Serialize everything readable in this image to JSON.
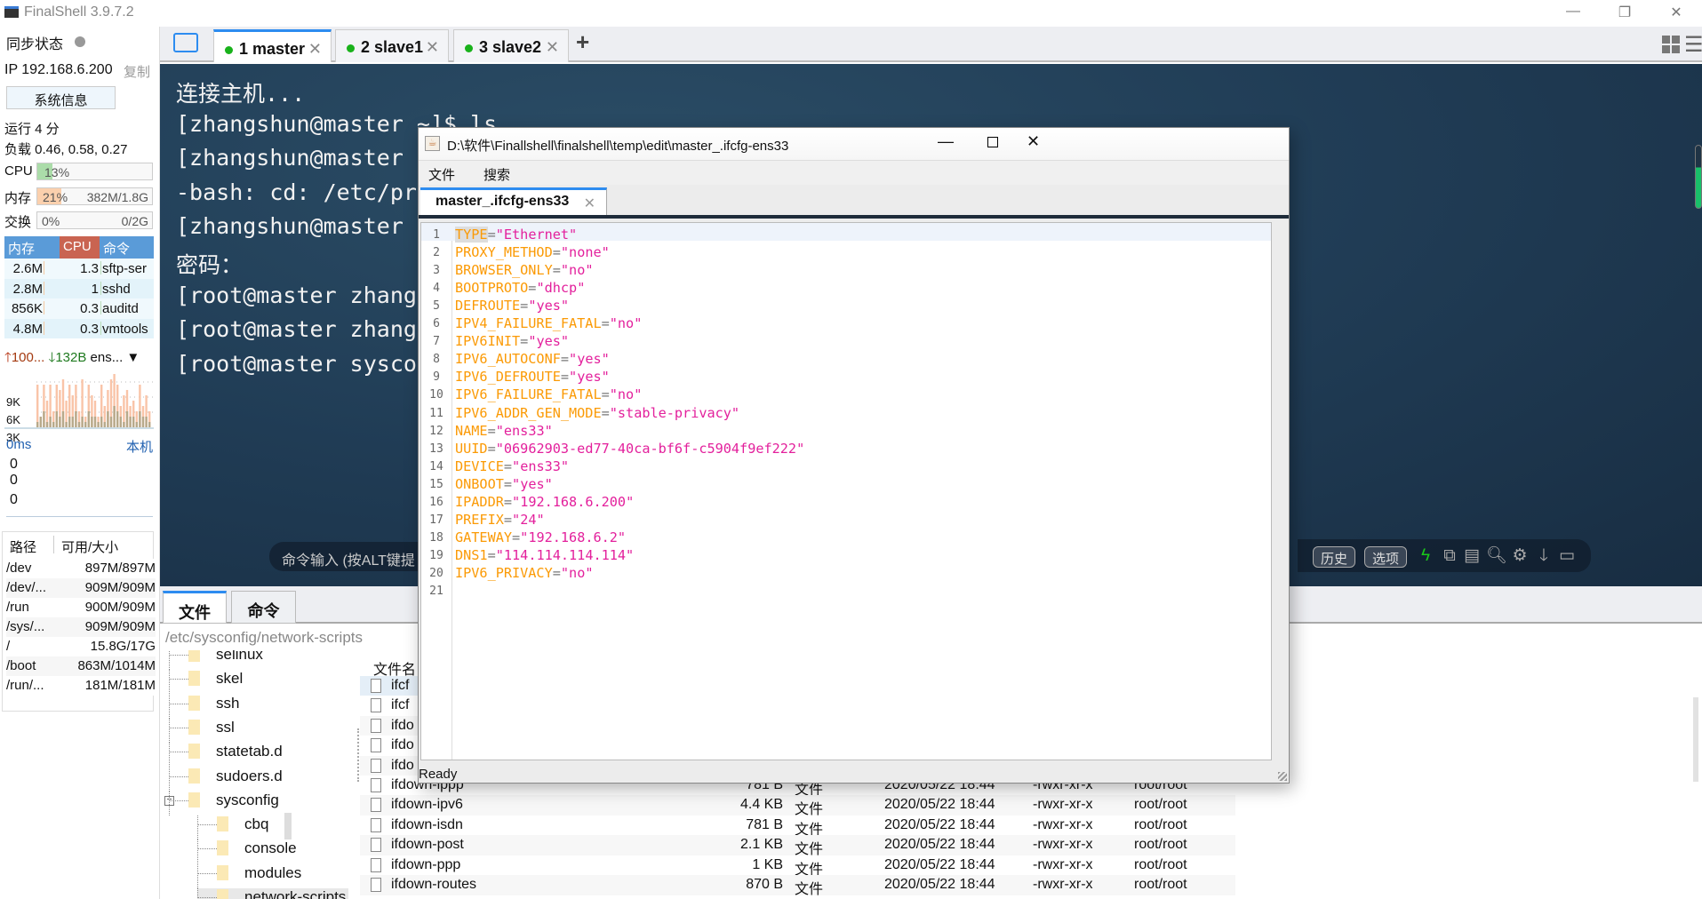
{
  "app": {
    "title": "FinalShell 3.9.7.2"
  },
  "sidebar": {
    "sync_label": "同步状态",
    "ip": "IP 192.168.6.200",
    "copy": "复制",
    "sysinfo_button": "系统信息",
    "uptime": "运行 4 分",
    "load": "负载 0.46, 0.58, 0.27",
    "cpu": {
      "label": "CPU",
      "percent": 13,
      "text": "13%"
    },
    "mem": {
      "label": "内存",
      "percent": 21,
      "text": "21%",
      "detail": "382M/1.8G"
    },
    "swap": {
      "label": "交换",
      "percent": 0,
      "text": "0%",
      "detail": "0/2G"
    },
    "proc_headers": [
      "内存",
      "CPU",
      "命令"
    ],
    "procs": [
      {
        "mem": "2.6M",
        "cpu": "1.3",
        "cmd": "sftp-ser"
      },
      {
        "mem": "2.8M",
        "cpu": "1",
        "cmd": "sshd"
      },
      {
        "mem": "856K",
        "cpu": "0.3",
        "cmd": "auditd"
      },
      {
        "mem": "4.8M",
        "cpu": "0.3",
        "cmd": "vmtools"
      }
    ],
    "net": {
      "up": "100...",
      "down": "132B",
      "iface": "ens...",
      "y_ticks": [
        "9K",
        "6K",
        "3K"
      ],
      "up_series": [
        8,
        1,
        8,
        5,
        8,
        3,
        8,
        7,
        9,
        5,
        8,
        6,
        8,
        3,
        9,
        2,
        8,
        6,
        5,
        2,
        8,
        4,
        7,
        9,
        10,
        8,
        4,
        6,
        7,
        4,
        5,
        3,
        8,
        4,
        6,
        3
      ],
      "down_series": [
        1,
        2,
        3,
        1,
        2,
        1,
        3,
        2,
        3,
        1,
        2,
        2,
        3,
        1,
        2,
        1,
        3,
        2,
        2,
        1,
        2,
        1,
        3,
        2,
        4,
        3,
        2,
        1,
        3,
        2,
        2,
        1,
        3,
        2,
        2,
        1
      ]
    },
    "ping": {
      "latency": "0ms",
      "target": "本机",
      "values": [
        "0",
        "0",
        "0"
      ]
    },
    "disk_headers": [
      "路径",
      "可用/大小"
    ],
    "disks": [
      {
        "path": "/dev",
        "size": "897M/897M"
      },
      {
        "path": "/dev/...",
        "size": "909M/909M"
      },
      {
        "path": "/run",
        "size": "900M/909M"
      },
      {
        "path": "/sys/...",
        "size": "909M/909M"
      },
      {
        "path": "/",
        "size": "15.8G/17G"
      },
      {
        "path": "/boot",
        "size": "863M/1014M"
      },
      {
        "path": "/run/...",
        "size": "181M/181M"
      }
    ]
  },
  "tabs": [
    {
      "label": "1 master"
    },
    {
      "label": "2 slave1"
    },
    {
      "label": "3 slave2"
    }
  ],
  "terminal": {
    "lines": [
      "连接主机...",
      "[zhangshun@master ~]$ ls",
      "[zhangshun@master ",
      "-bash: cd: /etc/pr",
      "[zhangshun@master ",
      "密码：",
      "[root@master zhang",
      "[root@master zhang",
      "[root@master sysco"
    ],
    "cmd_placeholder": "命令输入 (按ALT键提",
    "history": "历史",
    "options": "选项"
  },
  "bottom": {
    "tabs": [
      "文件",
      "命令"
    ],
    "path": "/etc/sysconfig/network-scripts",
    "tree": [
      "selinux",
      "skel",
      "ssh",
      "ssl",
      "statetab.d",
      "sudoers.d",
      "sysconfig",
      "cbq",
      "console",
      "modules",
      "network-scripts"
    ],
    "file_header": "文件名",
    "files": [
      {
        "name": "ifcf"
      },
      {
        "name": "ifcf"
      },
      {
        "name": "ifdo"
      },
      {
        "name": "ifdo"
      },
      {
        "name": "ifdo"
      },
      {
        "name": "ifdown-ippp",
        "size": "781 B",
        "type": "文件",
        "date": "2020/05/22 18:44",
        "perm": "-rwxr-xr-x",
        "owner": "root/root"
      },
      {
        "name": "ifdown-ipv6",
        "size": "4.4 KB",
        "type": "文件",
        "date": "2020/05/22 18:44",
        "perm": "-rwxr-xr-x",
        "owner": "root/root"
      },
      {
        "name": "ifdown-isdn",
        "size": "781 B",
        "type": "文件",
        "date": "2020/05/22 18:44",
        "perm": "-rwxr-xr-x",
        "owner": "root/root"
      },
      {
        "name": "ifdown-post",
        "size": "2.1 KB",
        "type": "文件",
        "date": "2020/05/22 18:44",
        "perm": "-rwxr-xr-x",
        "owner": "root/root"
      },
      {
        "name": "ifdown-ppp",
        "size": "1 KB",
        "type": "文件",
        "date": "2020/05/22 18:44",
        "perm": "-rwxr-xr-x",
        "owner": "root/root"
      },
      {
        "name": "ifdown-routes",
        "size": "870 B",
        "type": "文件",
        "date": "2020/05/22 18:44",
        "perm": "-rwxr-xr-x",
        "owner": "root/root"
      }
    ]
  },
  "editor": {
    "title": "D:\\软件\\Finallshell\\finalshell\\temp\\edit\\master_.ifcfg-ens33",
    "menu": [
      "文件",
      "搜索"
    ],
    "tab": "master_.ifcfg-ens33",
    "status": "Ready",
    "lines": [
      [
        "TYPE",
        "Ethernet"
      ],
      [
        "PROXY_METHOD",
        "none"
      ],
      [
        "BROWSER_ONLY",
        "no"
      ],
      [
        "BOOTPROTO",
        "dhcp"
      ],
      [
        "DEFROUTE",
        "yes"
      ],
      [
        "IPV4_FAILURE_FATAL",
        "no"
      ],
      [
        "IPV6INIT",
        "yes"
      ],
      [
        "IPV6_AUTOCONF",
        "yes"
      ],
      [
        "IPV6_DEFROUTE",
        "yes"
      ],
      [
        "IPV6_FAILURE_FATAL",
        "no"
      ],
      [
        "IPV6_ADDR_GEN_MODE",
        "stable-privacy"
      ],
      [
        "NAME",
        "ens33"
      ],
      [
        "UUID",
        "06962903-ed77-40ca-bf6f-c5904f9ef222"
      ],
      [
        "DEVICE",
        "ens33"
      ],
      [
        "ONBOOT",
        "yes"
      ],
      [
        "IPADDR",
        "192.168.6.200"
      ],
      [
        "PREFIX",
        "24"
      ],
      [
        "GATEWAY",
        "192.168.6.2"
      ],
      [
        "DNS1",
        "114.114.114.114"
      ],
      [
        "IPV6_PRIVACY",
        "no"
      ],
      [
        "",
        ""
      ]
    ]
  },
  "colors": {
    "accent": "#2d8cf0",
    "key": "#fb9a05",
    "string": "#e3209c",
    "online": "#19b21b"
  }
}
